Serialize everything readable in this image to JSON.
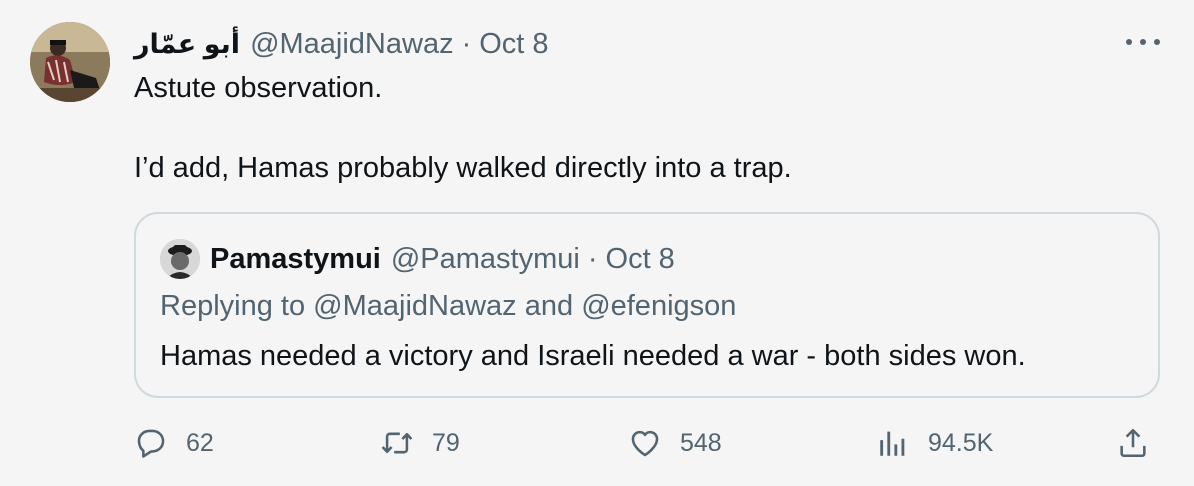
{
  "tweet": {
    "display_name": "أبو عمّار",
    "handle": "@MaajidNawaz",
    "separator": "·",
    "date": "Oct 8",
    "text_line1": "Astute observation.",
    "text_line2": "I’d add, Hamas probably walked directly into a trap."
  },
  "quote": {
    "display_name": "Pamastymui",
    "handle": "@Pamastymui",
    "separator": "·",
    "date": "Oct 8",
    "replying_prefix": "Replying to",
    "replying_user1": "@MaajidNawaz",
    "replying_and": "and",
    "replying_user2": "@efenigson",
    "text": "Hamas needed a victory and Israeli needed a war - both sides won."
  },
  "actions": {
    "replies": "62",
    "retweets": "79",
    "likes": "548",
    "views": "94.5K"
  },
  "icons": {
    "more": "more-dots-icon",
    "reply": "reply-icon",
    "retweet": "retweet-icon",
    "like": "heart-icon",
    "views": "views-icon",
    "share": "share-icon"
  },
  "colors": {
    "text_primary": "#0f1419",
    "text_secondary": "#536471",
    "border": "#cfd9de",
    "background": "#f5f5f5"
  }
}
